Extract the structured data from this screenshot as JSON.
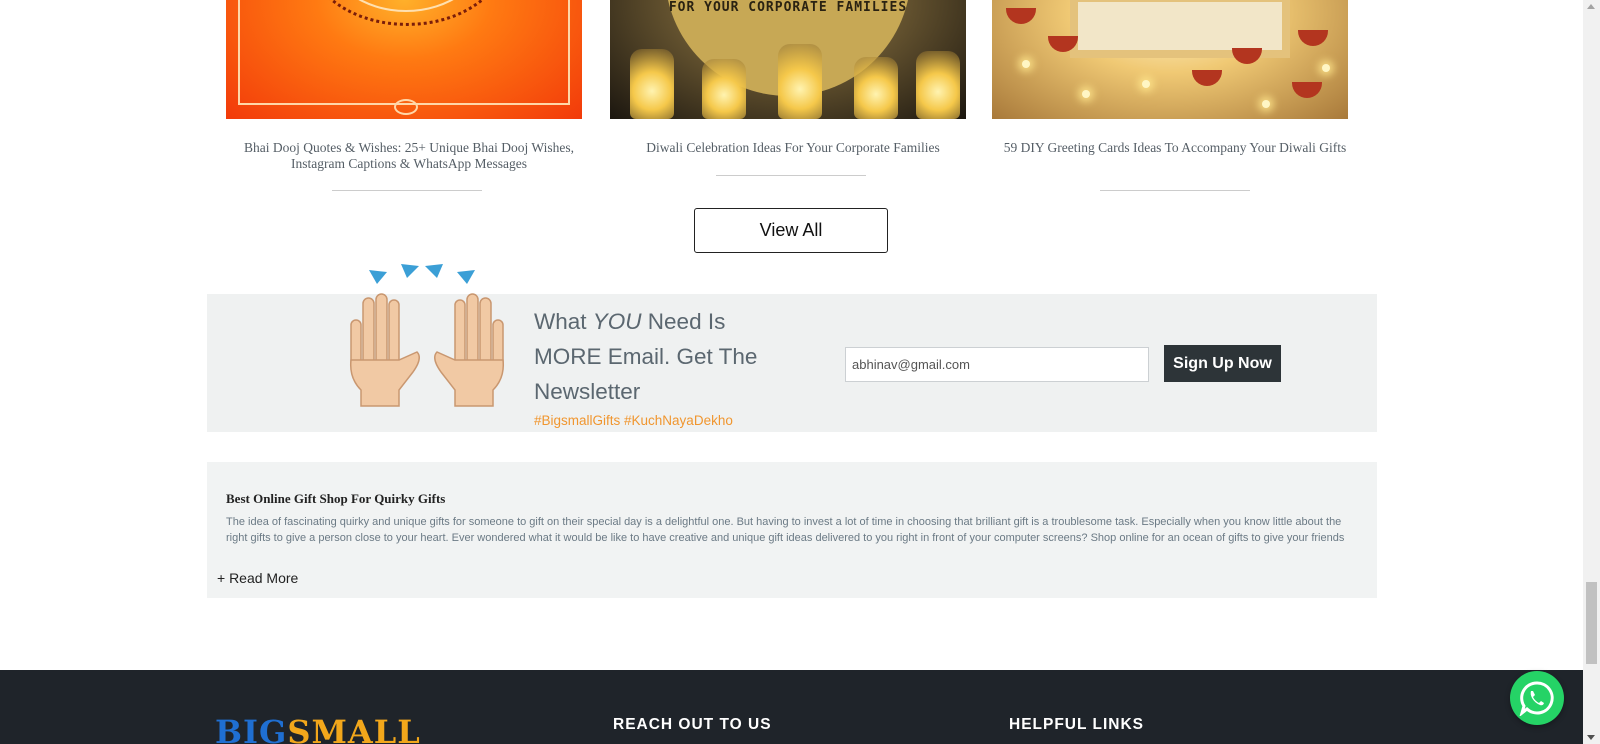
{
  "blog": {
    "cards": [
      {
        "title": "Bhai Dooj Quotes & Wishes: 25+ Unique Bhai Dooj Wishes, Instagram Captions & WhatsApp Messages"
      },
      {
        "title": "Diwali Celebration Ideas For Your Corporate Families",
        "image_caption": "FOR YOUR CORPORATE FAMILIES"
      },
      {
        "title": "59 DIY Greeting Cards Ideas To Accompany Your Diwali Gifts"
      }
    ],
    "view_all_label": "View All"
  },
  "newsletter": {
    "heading_part1": "What ",
    "heading_emphasis": "YOU",
    "heading_part2": " Need Is MORE Email. Get The Newsletter",
    "hashtags": "#BigsmallGifts #KuchNayaDekho",
    "email_value": "abhinav@gmail.com",
    "signup_label": "Sign Up Now"
  },
  "seo": {
    "title": "Best Online Gift Shop For Quirky Gifts",
    "text": "The idea of fascinating quirky and unique gifts for someone to gift on their special day is a delightful one. But having to invest a lot of time in choosing that brilliant gift is a troublesome task. Especially when you know little about the right gifts to give a person close to your heart. Ever wondered what it would be like to have creative and unique gift ideas delivered to you right in front of your computer screens? Shop online for an ocean of gifts to give your friends and family",
    "read_more_label": "+ Read More"
  },
  "footer": {
    "logo_part1": "BIG",
    "logo_part2": "SMALL",
    "reach_out_heading": "REACH OUT TO US",
    "helpful_links_heading": "HELPFUL LINKS"
  },
  "colors": {
    "accent_orange": "#f0962f",
    "footer_bg": "#1f242a",
    "whatsapp_green": "#25d366",
    "logo_blue": "#1f6fd2",
    "logo_orange": "#f2a71b"
  },
  "icons": {
    "floating": "whatsapp-icon",
    "newsletter": "raised-hands-icon"
  }
}
